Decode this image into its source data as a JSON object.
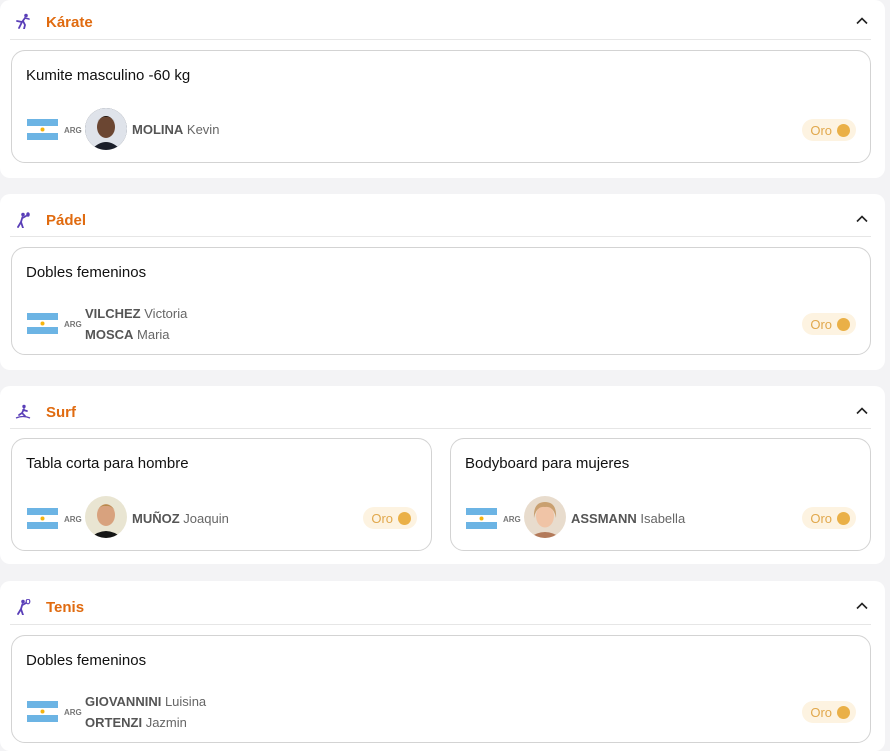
{
  "sections": [
    {
      "sport": "Kárate",
      "icon": "karate-icon",
      "events": [
        {
          "event": "Kumite masculino -60 kg",
          "noc": "ARG",
          "athletes": [
            {
              "surname": "MOLINA",
              "given": "Kevin"
            }
          ],
          "medal": "Oro"
        }
      ]
    },
    {
      "sport": "Pádel",
      "icon": "padel-icon",
      "events": [
        {
          "event": "Dobles femeninos",
          "noc": "ARG",
          "athletes": [
            {
              "surname": "VILCHEZ",
              "given": "Victoria"
            },
            {
              "surname": "MOSCA",
              "given": "Maria"
            }
          ],
          "medal": "Oro"
        }
      ]
    },
    {
      "sport": "Surf",
      "icon": "surf-icon",
      "events": [
        {
          "event": "Tabla corta para hombre",
          "noc": "ARG",
          "athletes": [
            {
              "surname": "MUÑOZ",
              "given": "Joaquin"
            }
          ],
          "medal": "Oro"
        },
        {
          "event": "Bodyboard para mujeres",
          "noc": "ARG",
          "athletes": [
            {
              "surname": "ASSMANN",
              "given": "Isabella"
            }
          ],
          "medal": "Oro"
        }
      ]
    },
    {
      "sport": "Tenis",
      "icon": "tennis-icon",
      "events": [
        {
          "event": "Dobles femeninos",
          "noc": "ARG",
          "athletes": [
            {
              "surname": "GIOVANNINI",
              "given": "Luisina"
            },
            {
              "surname": "ORTENZI",
              "given": "Jazmin"
            }
          ],
          "medal": "Oro"
        }
      ]
    }
  ],
  "colors": {
    "sport_title": "#e06b10",
    "sport_icon": "#5a3fb8",
    "gold": "#eab047",
    "gold_bg": "#fdf3e1",
    "flag_blue": "#6cb4e4",
    "flag_sun": "#f6b40e"
  }
}
